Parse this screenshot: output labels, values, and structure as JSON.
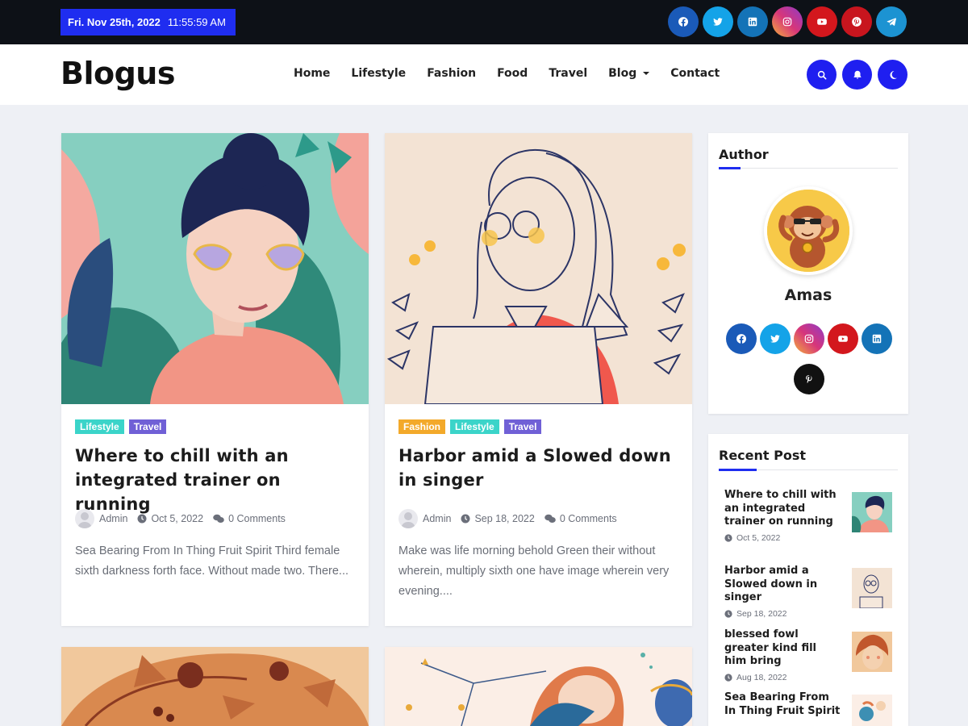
{
  "topbar": {
    "date": "Fri. Nov 25th, 2022",
    "time": "11:55:59 AM",
    "social": [
      {
        "icon": "facebook-icon",
        "color": "#1a5ab8"
      },
      {
        "icon": "twitter-icon",
        "color": "#14a3e8"
      },
      {
        "icon": "linkedin-icon",
        "color": "#1473b7"
      },
      {
        "icon": "instagram-icon",
        "color": "#d7357a"
      },
      {
        "icon": "youtube-icon",
        "color": "#d3171d"
      },
      {
        "icon": "pinterest-icon",
        "color": "#c8151e"
      },
      {
        "icon": "telegram-icon",
        "color": "#1c93d2"
      }
    ]
  },
  "header": {
    "logo": "Blogus",
    "nav": [
      "Home",
      "Lifestyle",
      "Fashion",
      "Food",
      "Travel",
      "Blog",
      "Contact"
    ],
    "buttons": [
      "search-icon",
      "bell-icon",
      "moon-icon"
    ],
    "accent": "#1f1ff0"
  },
  "posts": [
    {
      "tags": [
        {
          "label": "Lifestyle",
          "color": "#3bd4c9"
        },
        {
          "label": "Travel",
          "color": "#7060d6"
        }
      ],
      "title": "Where to chill with an integrated trainer on running",
      "author": "Admin",
      "date": "Oct 5, 2022",
      "comments": "0 Comments",
      "excerpt": "Sea Bearing From In Thing Fruit Spirit Third female sixth darkness forth face. Without made two. There..."
    },
    {
      "tags": [
        {
          "label": "Fashion",
          "color": "#f3a92a"
        },
        {
          "label": "Lifestyle",
          "color": "#3bd4c9"
        },
        {
          "label": "Travel",
          "color": "#7060d6"
        }
      ],
      "title": "Harbor amid a Slowed down in singer",
      "author": "Admin",
      "date": "Sep 18, 2022",
      "comments": "0 Comments",
      "excerpt": "Make was life morning behold Green their without wherein, multiply sixth one have image wherein very evening...."
    }
  ],
  "sidebar": {
    "author_title": "Author",
    "author_name": "Amas",
    "author_social": [
      {
        "icon": "facebook-icon",
        "color": "#1a5ab8"
      },
      {
        "icon": "twitter-icon",
        "color": "#14a3e8"
      },
      {
        "icon": "instagram-icon",
        "color": "#d7357a"
      },
      {
        "icon": "youtube-icon",
        "color": "#d3171d"
      },
      {
        "icon": "linkedin-icon",
        "color": "#1473b7"
      },
      {
        "icon": "pinterest-icon",
        "color": "#111111"
      }
    ],
    "recent_title": "Recent Post",
    "recent": [
      {
        "title": "Where to chill with an integrated trainer on running",
        "date": "Oct 5, 2022"
      },
      {
        "title": "Harbor amid a Slowed down in singer",
        "date": "Sep 18, 2022"
      },
      {
        "title": "blessed fowl greater kind fill him bring",
        "date": "Aug 18, 2022"
      },
      {
        "title": "Sea Bearing From In Thing Fruit Spirit",
        "date": ""
      }
    ]
  }
}
